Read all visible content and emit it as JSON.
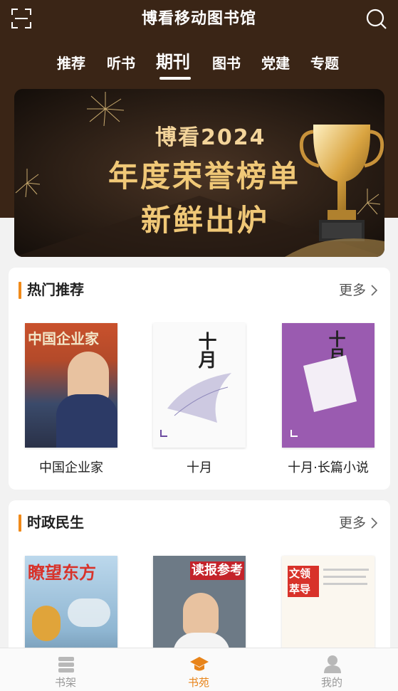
{
  "header": {
    "title": "博看移动图书馆",
    "scan_icon": "scan-icon",
    "search_icon": "search-icon"
  },
  "tabs": [
    {
      "label": "推荐",
      "active": false
    },
    {
      "label": "听书",
      "active": false
    },
    {
      "label": "期刊",
      "active": true
    },
    {
      "label": "图书",
      "active": false
    },
    {
      "label": "党建",
      "active": false
    },
    {
      "label": "专题",
      "active": false
    }
  ],
  "banner": {
    "line1": "博看2024",
    "line2": "年度荣誉榜单",
    "line3": "新鲜出炉",
    "dots": 3,
    "active_dot": 1
  },
  "sections": [
    {
      "title": "热门推荐",
      "more_label": "更多",
      "items": [
        {
          "title": "中国企业家",
          "cover_text": "中国企业家"
        },
        {
          "title": "十月",
          "cover_text": "十月"
        },
        {
          "title": "十月·长篇小说",
          "cover_text": "十月"
        }
      ]
    },
    {
      "title": "时政民生",
      "more_label": "更多",
      "items": [
        {
          "title": "",
          "cover_text": "瞭望东方"
        },
        {
          "title": "",
          "cover_text": "读报参考"
        },
        {
          "title": "",
          "cover_text": "文领萃导"
        }
      ]
    }
  ],
  "bottom_nav": [
    {
      "label": "书架",
      "icon": "books-icon",
      "active": false
    },
    {
      "label": "书苑",
      "icon": "graduation-cap-icon",
      "active": true
    },
    {
      "label": "我的",
      "icon": "user-icon",
      "active": false
    }
  ],
  "colors": {
    "header_bg": "#3a2516",
    "accent": "#f08a1a",
    "nav_active": "#e8841a"
  }
}
